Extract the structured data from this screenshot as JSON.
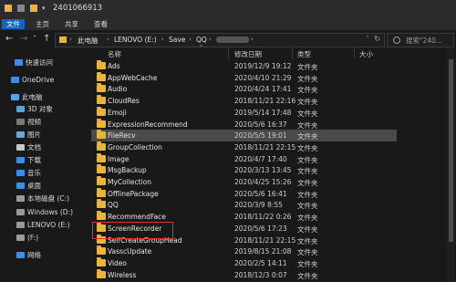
{
  "window": {
    "title": "2401066913"
  },
  "ribbon": {
    "tabs": [
      "文件",
      "主页",
      "共享",
      "查看"
    ]
  },
  "navbar": {
    "back": "←",
    "forward": "→",
    "down": "˅",
    "up": "↑",
    "crumbs": [
      "此电脑",
      "LENOVO (E:)",
      "Save",
      "QQ"
    ],
    "search_placeholder": "搜索\"240..."
  },
  "sidebar": {
    "items": [
      {
        "label": "快速访问",
        "icon": "star-icon",
        "color": "#3a8ee6"
      },
      {
        "label": "OneDrive",
        "icon": "cloud-icon",
        "color": "#3a8ee6"
      },
      {
        "label": "此电脑",
        "icon": "computer-icon",
        "color": "#5aa0e0"
      },
      {
        "label": "3D 对象",
        "icon": "cube-icon",
        "color": "#58a6d6"
      },
      {
        "label": "视频",
        "icon": "video-icon",
        "color": "#7a7a7a"
      },
      {
        "label": "图片",
        "icon": "picture-icon",
        "color": "#6aa8d8"
      },
      {
        "label": "文档",
        "icon": "document-icon",
        "color": "#c8c8c8"
      },
      {
        "label": "下载",
        "icon": "download-icon",
        "color": "#3a8ee6"
      },
      {
        "label": "音乐",
        "icon": "music-icon",
        "color": "#3a8ee6"
      },
      {
        "label": "桌面",
        "icon": "desktop-icon",
        "color": "#3a8ee6"
      },
      {
        "label": "本地磁盘 (C:)",
        "icon": "drive-icon",
        "color": "#9a9a9a"
      },
      {
        "label": "Windows (D:)",
        "icon": "drive-icon",
        "color": "#9a9a9a"
      },
      {
        "label": "LENOVO (E:)",
        "icon": "drive-icon",
        "color": "#9a9a9a"
      },
      {
        "label": "(F:)",
        "icon": "drive-icon",
        "color": "#9a9a9a"
      },
      {
        "label": "网络",
        "icon": "network-icon",
        "color": "#3a8ee6"
      }
    ]
  },
  "columns": {
    "name": "名称",
    "date": "修改日期",
    "type": "类型",
    "size": "大小"
  },
  "files": [
    {
      "name": "Ads",
      "date": "2019/12/9 19:12",
      "type": "文件夹"
    },
    {
      "name": "AppWebCache",
      "date": "2020/4/10 21:29",
      "type": "文件夹"
    },
    {
      "name": "Audio",
      "date": "2020/4/24 17:41",
      "type": "文件夹"
    },
    {
      "name": "CloudRes",
      "date": "2018/11/21 22:16",
      "type": "文件夹"
    },
    {
      "name": "Emoji",
      "date": "2019/5/14 17:48",
      "type": "文件夹"
    },
    {
      "name": "ExpressionRecommend",
      "date": "2020/5/6 16:37",
      "type": "文件夹"
    },
    {
      "name": "FileRecv",
      "date": "2020/5/5 19:01",
      "type": "文件夹"
    },
    {
      "name": "GroupCollection",
      "date": "2018/11/21 22:15",
      "type": "文件夹"
    },
    {
      "name": "Image",
      "date": "2020/4/7 17:40",
      "type": "文件夹"
    },
    {
      "name": "MsgBackup",
      "date": "2020/3/13 13:45",
      "type": "文件夹"
    },
    {
      "name": "MyCollection",
      "date": "2020/4/25 15:26",
      "type": "文件夹"
    },
    {
      "name": "OfflinePackage",
      "date": "2020/5/6 16:41",
      "type": "文件夹"
    },
    {
      "name": "QQ",
      "date": "2020/3/9 8:55",
      "type": "文件夹"
    },
    {
      "name": "RecommendFace",
      "date": "2018/11/22 0:26",
      "type": "文件夹"
    },
    {
      "name": "ScreenRecorder",
      "date": "2020/5/6 17:23",
      "type": "文件夹"
    },
    {
      "name": "SelfCreateGroupHead",
      "date": "2018/11/21 22:15",
      "type": "文件夹"
    },
    {
      "name": "VasscUpdate",
      "date": "2019/8/15 21:08",
      "type": "文件夹"
    },
    {
      "name": "Video",
      "date": "2020/2/5 14:11",
      "type": "文件夹"
    },
    {
      "name": "Wireless",
      "date": "2018/12/3 0:07",
      "type": "文件夹"
    }
  ],
  "selected_row": "FileRecv",
  "highlighted_row": "ScreenRecorder"
}
